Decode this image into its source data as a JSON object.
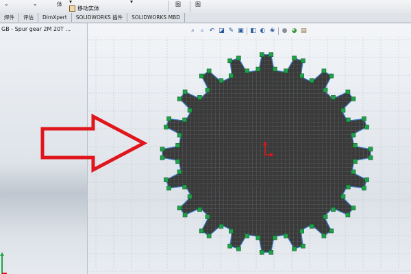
{
  "toolbar": {
    "fragment_1": "体",
    "fragment_2": "▾",
    "move_body_label": "移动实体",
    "fragment_3": "图"
  },
  "tabs": [
    {
      "label": "焊件"
    },
    {
      "label": "评估"
    },
    {
      "label": "DimXpert"
    },
    {
      "label": "SOLIDWORKS 插件"
    },
    {
      "label": "SOLIDWORKS MBD"
    }
  ],
  "document": {
    "title": "GB - Spur gear 2M 20T ..."
  },
  "heads_up_toolbar": {
    "icons": [
      "zoom-to-fit-icon",
      "zoom-to-area-icon",
      "previous-view-icon",
      "section-view-icon",
      "dynamic-annotation-icon",
      "view-orientation-icon",
      "display-style-icon",
      "hide-show-items-icon",
      "edit-appearance-icon",
      "apply-scene-icon",
      "view-settings-icon",
      "display-pane-icon"
    ]
  },
  "model": {
    "teeth": 20,
    "body_color": "#3a3a3a",
    "mesh_color": "#8a8f96",
    "edge_color": "#3a7fd0",
    "vertex_marker_color": "#1fa24a",
    "annotation_arrow_color": "#e0161c"
  }
}
